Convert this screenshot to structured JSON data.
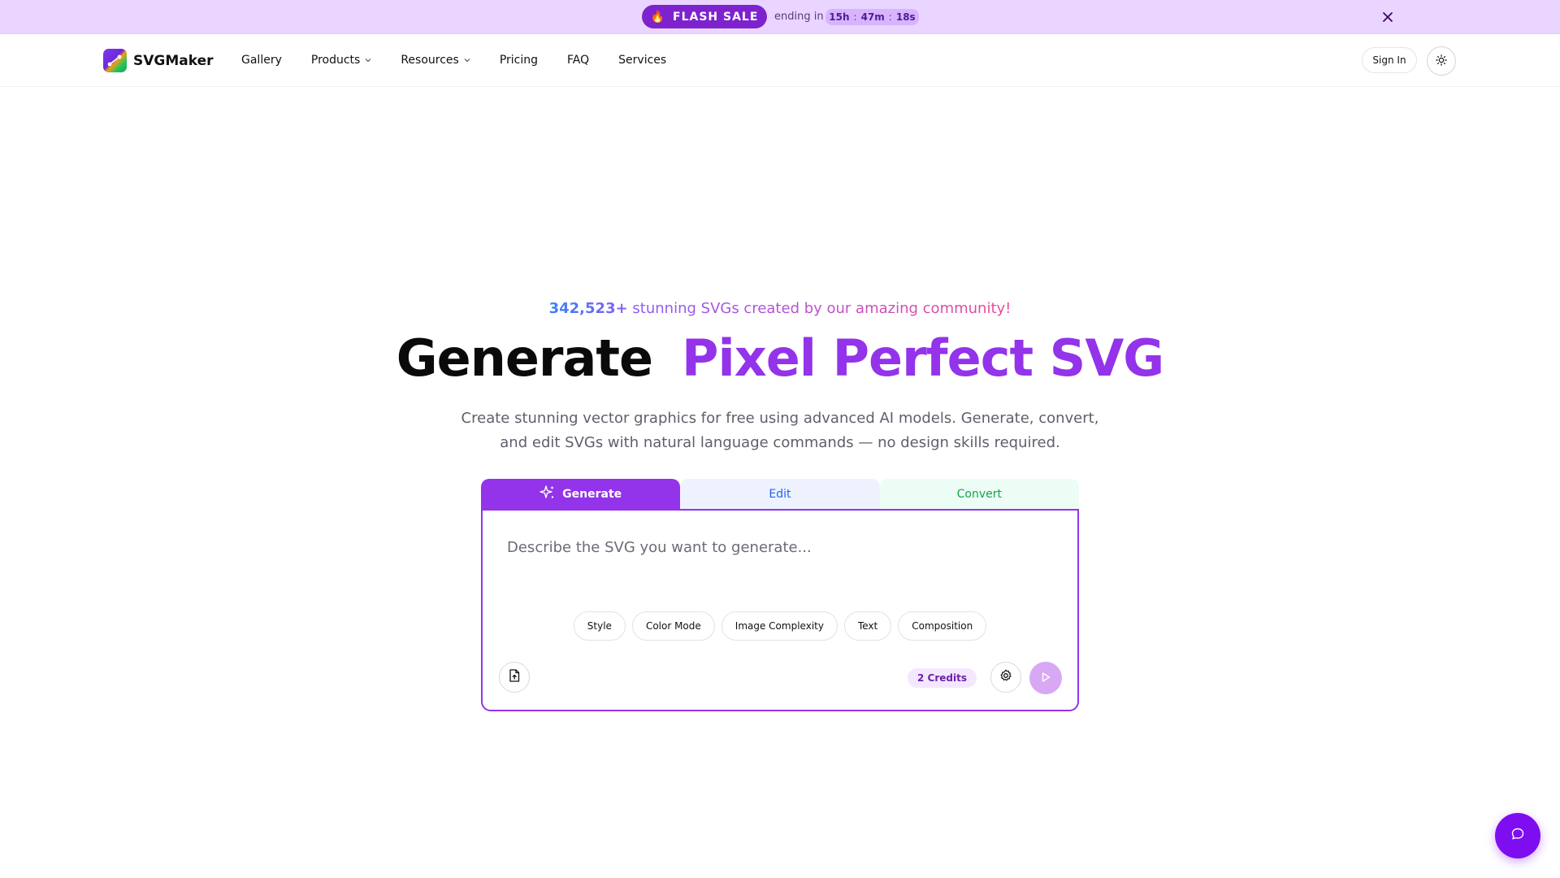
{
  "promo": {
    "badge_icon": "fire-icon",
    "badge_label": "FLASH SALE",
    "ending_label": "ending in",
    "timer": {
      "hours": "15h",
      "minutes": "47m",
      "seconds": "18s",
      "separator": ":"
    },
    "close_icon": "close-icon",
    "background_color": "#e9d5ff"
  },
  "header": {
    "logo_text": "SVGMaker",
    "nav": [
      {
        "label": "Gallery",
        "dropdown": false
      },
      {
        "label": "Products",
        "dropdown": true
      },
      {
        "label": "Resources",
        "dropdown": true
      },
      {
        "label": "Pricing",
        "dropdown": false
      },
      {
        "label": "FAQ",
        "dropdown": false
      },
      {
        "label": "Services",
        "dropdown": false
      }
    ],
    "sign_in_label": "Sign In",
    "theme_toggle_icon": "sun-icon"
  },
  "hero": {
    "community_count": "342,523+",
    "community_text": "stunning SVGs created by our amazing community!",
    "headline_part1": "Generate",
    "headline_part2": "Pixel Perfect SVG",
    "subtitle_line1": "Create stunning vector graphics for free using advanced AI models. Generate, convert,",
    "subtitle_line2": "and edit SVGs with natural language commands — no design skills required."
  },
  "tool": {
    "tabs": [
      {
        "label": "Generate",
        "icon": "sparkles-icon",
        "active": true
      },
      {
        "label": "Edit",
        "active": false
      },
      {
        "label": "Convert",
        "active": false
      }
    ],
    "prompt_placeholder": "Describe the SVG you want to generate...",
    "prompt_value": "",
    "options": [
      "Style",
      "Color Mode",
      "Image Complexity",
      "Text",
      "Composition"
    ],
    "upload_icon": "file-upload-icon",
    "credits_label": "2 Credits",
    "settings_icon": "gear-icon",
    "submit_icon": "play-icon",
    "accent_color": "#9333ea"
  },
  "chat": {
    "icon": "chat-bubble-icon",
    "color": "#7e0ef0"
  }
}
